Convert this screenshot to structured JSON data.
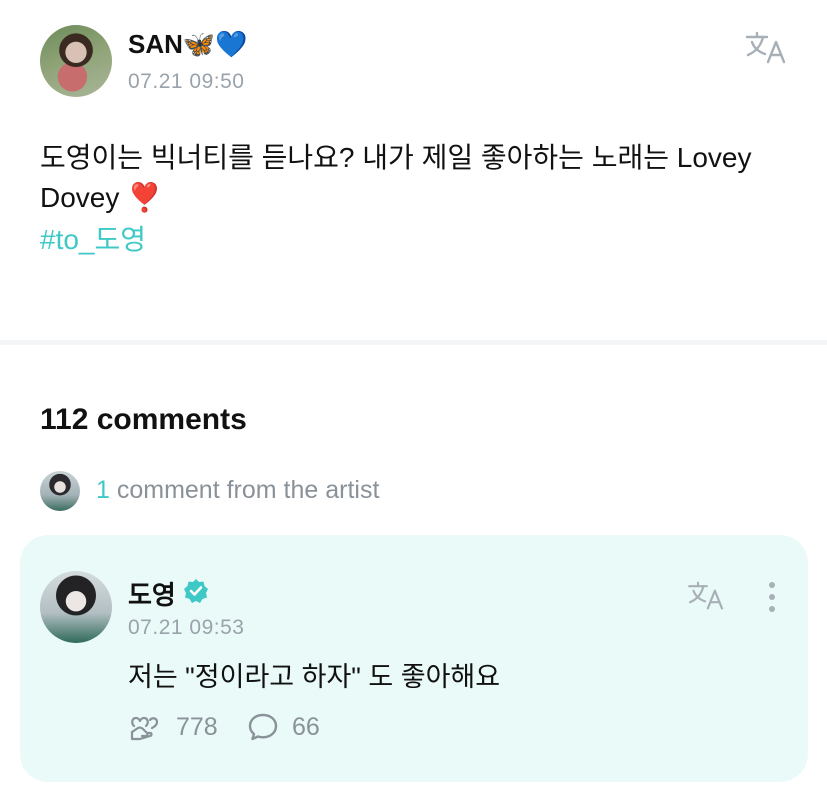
{
  "post": {
    "author": "SAN",
    "author_emoji": "🦋💙",
    "time": "07.21 09:50",
    "text_line1": "도영이는 빅너티를 듣나요? 내가 제일 좋아하는 노래는 Lovey",
    "text_line2": "Dovey ",
    "text_emoji": "❣️",
    "hashtag": "#to_도영"
  },
  "comments": {
    "count_label": "112 comments",
    "artist_count": "1",
    "artist_label": " comment from the artist"
  },
  "artist_comment": {
    "author": "도영",
    "time": "07.21 09:53",
    "text": "저는 \"정이라고 하자\" 도 좋아해요",
    "likes": "778",
    "replies": "66"
  },
  "icons": {
    "translate": "translate-icon",
    "more": "more-vertical-icon",
    "verified": "verified-badge-icon",
    "like": "heart-hand-icon",
    "reply": "speech-bubble-icon"
  },
  "colors": {
    "accent": "#3fc9c6",
    "muted_text": "#9aa3ab",
    "card_bg": "#eafaf8"
  }
}
